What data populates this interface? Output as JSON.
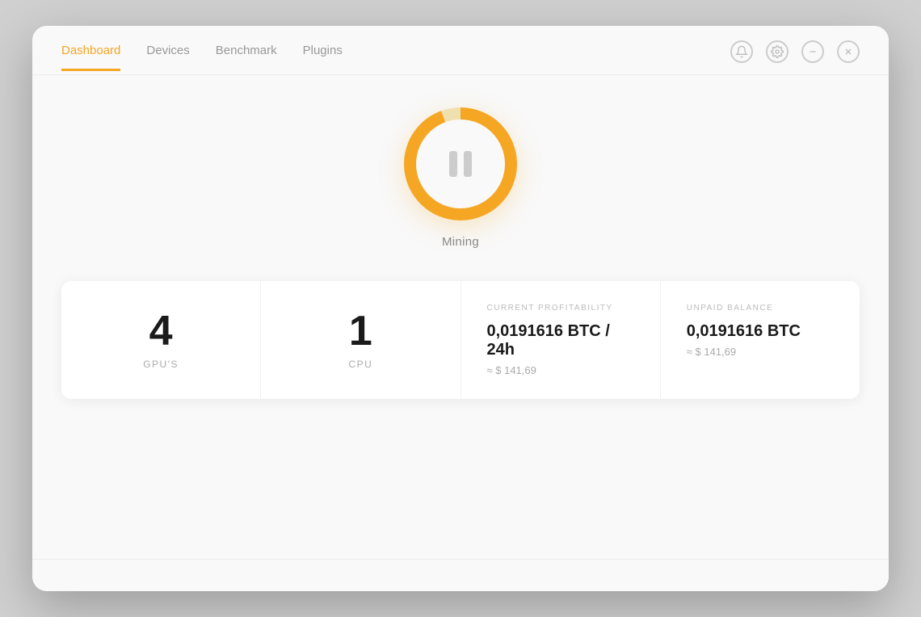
{
  "nav": {
    "links": [
      {
        "label": "Dashboard",
        "active": true
      },
      {
        "label": "Devices",
        "active": false
      },
      {
        "label": "Benchmark",
        "active": false
      },
      {
        "label": "Plugins",
        "active": false
      }
    ]
  },
  "window_controls": {
    "notification_icon": "🔔",
    "settings_icon": "⚙",
    "minimize_icon": "−",
    "close_icon": "✕"
  },
  "mining": {
    "status_label": "Mining"
  },
  "stats": [
    {
      "type": "simple",
      "number": "4",
      "label": "GPU'S"
    },
    {
      "type": "simple",
      "number": "1",
      "label": "CPU"
    },
    {
      "type": "detailed",
      "header": "CURRENT PROFITABILITY",
      "value_main": "0,0191616 BTC / 24h",
      "value_sub": "≈ $ 141,69"
    },
    {
      "type": "detailed",
      "header": "UNPAID BALANCE",
      "value_main": "0,0191616 BTC",
      "value_sub": "≈ $ 141,69"
    }
  ]
}
